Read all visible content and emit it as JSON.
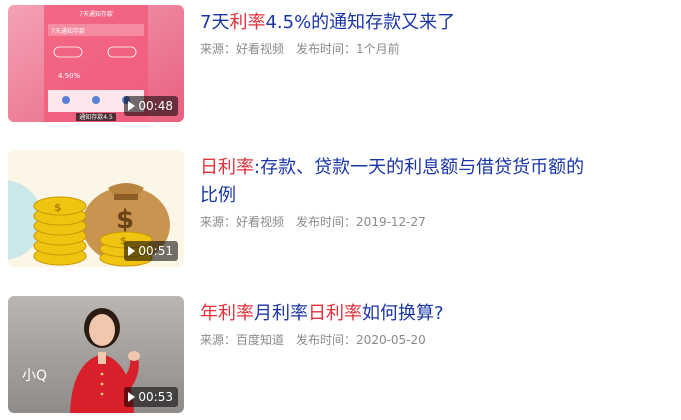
{
  "videos": [
    {
      "title_parts": [
        {
          "text": "7天",
          "hl": false
        },
        {
          "text": "利率",
          "hl": true
        },
        {
          "text": "4.5%的通知存款又来了",
          "hl": false
        }
      ],
      "source_label": "来源：",
      "source": "好看视频",
      "time_label": "发布时间：",
      "time": "1个月前",
      "duration": "00:48",
      "thumb_text": {
        "top": "7天通知存款",
        "row_label": "7天通知存款",
        "rate": "4.50%",
        "caption": "通知存款4.5"
      }
    },
    {
      "title_parts": [
        {
          "text": "日利率",
          "hl": true
        },
        {
          "text": ":存款、贷款一天的利息额与借贷货币额的比例",
          "hl": false
        }
      ],
      "source_label": "来源：",
      "source": "好看视频",
      "time_label": "发布时间：",
      "time": "2019-12-27",
      "duration": "00:51"
    },
    {
      "title_parts": [
        {
          "text": "年利率",
          "hl": true
        },
        {
          "text": "月利率",
          "hl": false
        },
        {
          "text": "日利率",
          "hl": true
        },
        {
          "text": "如何换算?",
          "hl": false
        }
      ],
      "source_label": "来源：",
      "source": "百度知道",
      "time_label": "发布时间：",
      "time": "2020-05-20",
      "duration": "00:53",
      "thumb_text": {
        "logo": "小Q"
      }
    }
  ],
  "colors": {
    "title": "#1a35a8",
    "highlight": "#e3303a",
    "meta": "#8a8a8a"
  }
}
